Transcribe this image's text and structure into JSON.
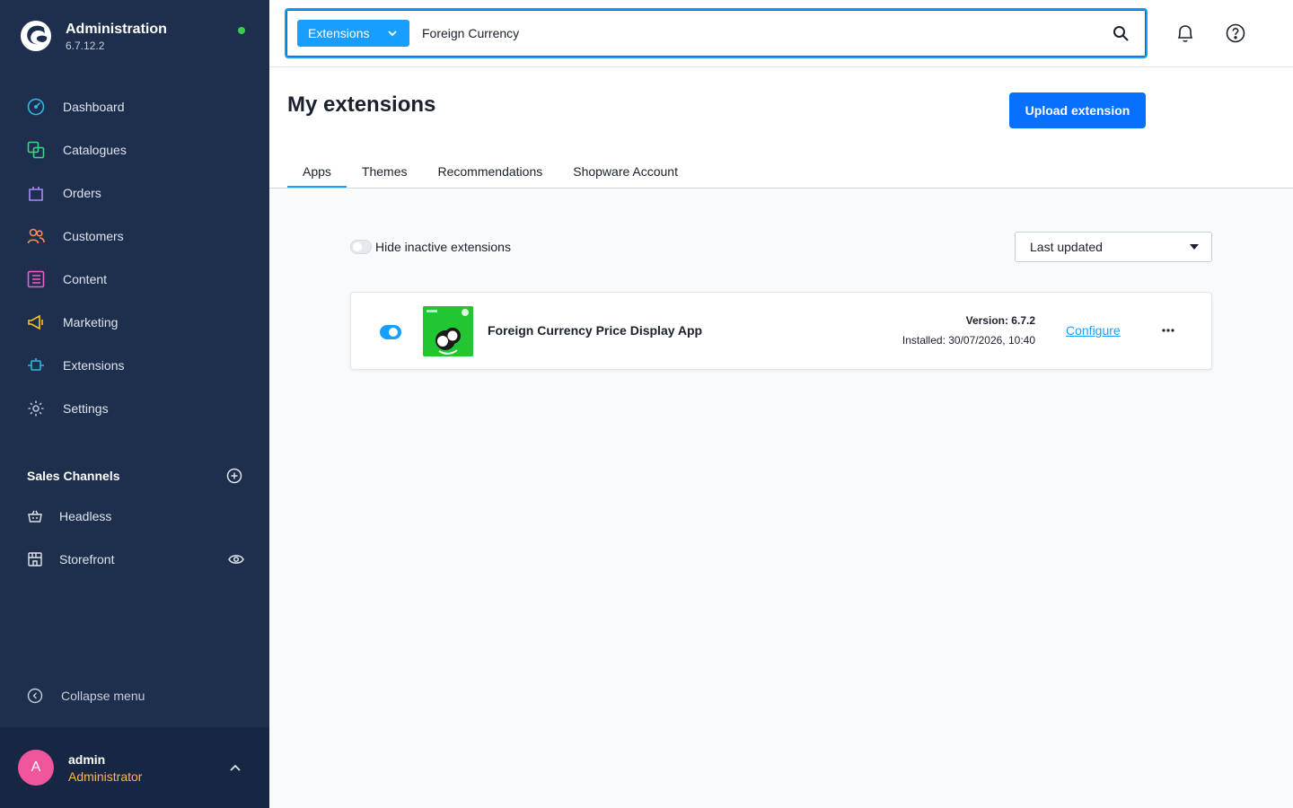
{
  "colors": {
    "sidebar_bg": "#1e2f4e",
    "accent": "#189eff",
    "primary_button": "#0870ff",
    "status_online": "#37d046",
    "avatar_bg": "#f0569b",
    "role_text": "#ffb74a"
  },
  "brand": {
    "title": "Administration",
    "version": "6.7.12.2",
    "logo_icon": "shopware-logo-icon"
  },
  "nav": {
    "items": [
      {
        "label": "Dashboard",
        "icon": "dashboard-icon"
      },
      {
        "label": "Catalogues",
        "icon": "catalogues-icon"
      },
      {
        "label": "Orders",
        "icon": "orders-icon"
      },
      {
        "label": "Customers",
        "icon": "customers-icon"
      },
      {
        "label": "Content",
        "icon": "content-icon"
      },
      {
        "label": "Marketing",
        "icon": "marketing-icon"
      },
      {
        "label": "Extensions",
        "icon": "extensions-icon"
      },
      {
        "label": "Settings",
        "icon": "settings-icon"
      }
    ]
  },
  "sales_channels": {
    "title": "Sales Channels",
    "items": [
      {
        "label": "Headless",
        "icon": "basket-icon"
      },
      {
        "label": "Storefront",
        "icon": "storefront-icon"
      }
    ]
  },
  "collapse": {
    "label": "Collapse menu"
  },
  "user": {
    "initial": "A",
    "name": "admin",
    "role": "Administrator"
  },
  "search": {
    "type_label": "Extensions",
    "value": "Foreign Currency"
  },
  "page": {
    "title": "My extensions",
    "upload_label": "Upload extension",
    "tabs": [
      {
        "label": "Apps",
        "active": true
      },
      {
        "label": "Themes",
        "active": false
      },
      {
        "label": "Recommendations",
        "active": false
      },
      {
        "label": "Shopware Account",
        "active": false
      }
    ]
  },
  "toolbar": {
    "hide_inactive_label": "Hide inactive extensions",
    "hide_inactive_on": false,
    "sort_selected": "Last updated"
  },
  "extensions": [
    {
      "name": "Foreign Currency Price Display App",
      "active": true,
      "version": "Version: 6.7.2",
      "installed": "Installed: 30/07/2026, 10:40",
      "configure_label": "Configure"
    }
  ]
}
